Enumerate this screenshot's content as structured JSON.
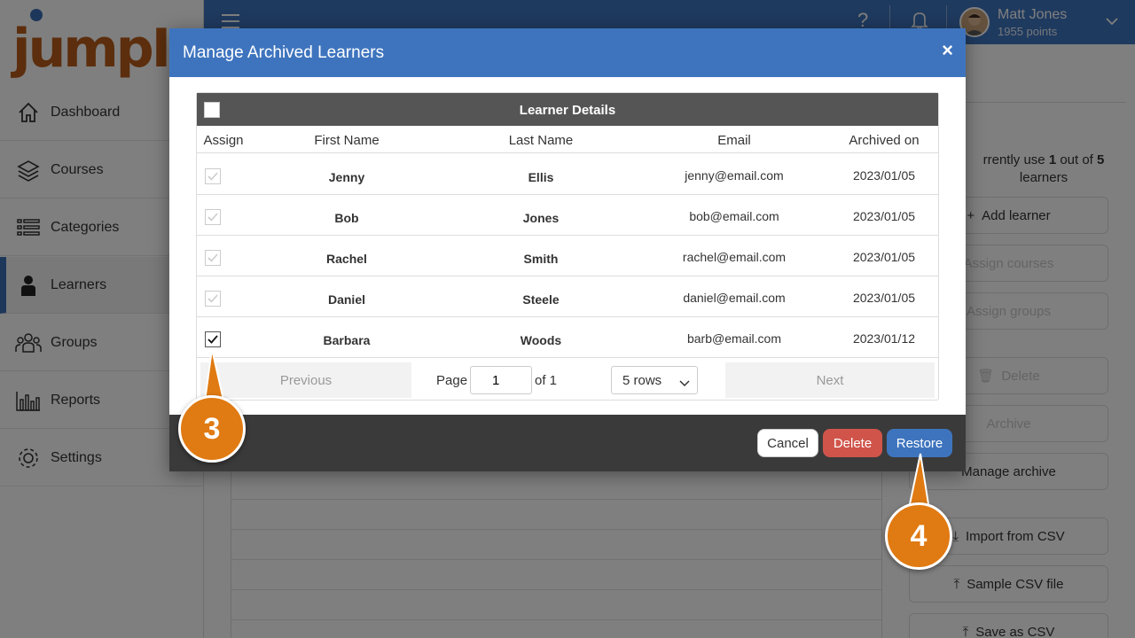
{
  "brand": {
    "logo_text": "jumpIn",
    "accent": "#3e74be",
    "orange": "#e07a12"
  },
  "sidebar": {
    "items": [
      {
        "label": "Dashboard",
        "icon": "home-icon"
      },
      {
        "label": "Courses",
        "icon": "layers-icon"
      },
      {
        "label": "Categories",
        "icon": "list-icon"
      },
      {
        "label": "Learners",
        "icon": "person-icon"
      },
      {
        "label": "Groups",
        "icon": "group-icon"
      },
      {
        "label": "Reports",
        "icon": "bar-chart-icon"
      },
      {
        "label": "Settings",
        "icon": "gear-icon"
      }
    ],
    "active": "Learners"
  },
  "topbar": {
    "user_name": "Matt Jones",
    "user_points": "1955 points"
  },
  "right_panel": {
    "usage_text_pre": "rrently use ",
    "usage_used": "1",
    "usage_mid": " out of ",
    "usage_total": "5",
    "usage_post": "learners",
    "buttons": [
      {
        "label": "Add learner",
        "disabled": false
      },
      {
        "label": "Assign courses",
        "disabled": true
      },
      {
        "label": "Assign groups",
        "disabled": true
      },
      {
        "label": "Delete",
        "disabled": true
      },
      {
        "label": "Archive",
        "disabled": true
      },
      {
        "label": "Manage archive",
        "disabled": false
      },
      {
        "label": "Import from CSV",
        "disabled": false
      },
      {
        "label": "Sample CSV file",
        "disabled": false
      },
      {
        "label": "Save as CSV",
        "disabled": false
      }
    ]
  },
  "modal": {
    "title": "Manage Archived Learners",
    "close_symbol": "×",
    "table_title": "Learner Details",
    "columns": [
      "Assign",
      "First Name",
      "Last Name",
      "Email",
      "Archived on"
    ],
    "rows": [
      {
        "first": "Jenny",
        "last": "Ellis",
        "email": "jenny@email.com",
        "archived": "2023/01/05",
        "checked": false
      },
      {
        "first": "Bob",
        "last": "Jones",
        "email": "bob@email.com",
        "archived": "2023/01/05",
        "checked": false
      },
      {
        "first": "Rachel",
        "last": "Smith",
        "email": "rachel@email.com",
        "archived": "2023/01/05",
        "checked": false
      },
      {
        "first": "Daniel",
        "last": "Steele",
        "email": "daniel@email.com",
        "archived": "2023/01/05",
        "checked": false
      },
      {
        "first": "Barbara",
        "last": "Woods",
        "email": "barb@email.com",
        "archived": "2023/01/12",
        "checked": true
      }
    ],
    "pager": {
      "previous": "Previous",
      "page_label": "Page",
      "page_value": "1",
      "of_label": "of 1",
      "rows_option": "5 rows",
      "next": "Next"
    },
    "buttons": {
      "cancel": "Cancel",
      "delete": "Delete",
      "restore": "Restore"
    }
  },
  "callouts": [
    "3",
    "4"
  ]
}
